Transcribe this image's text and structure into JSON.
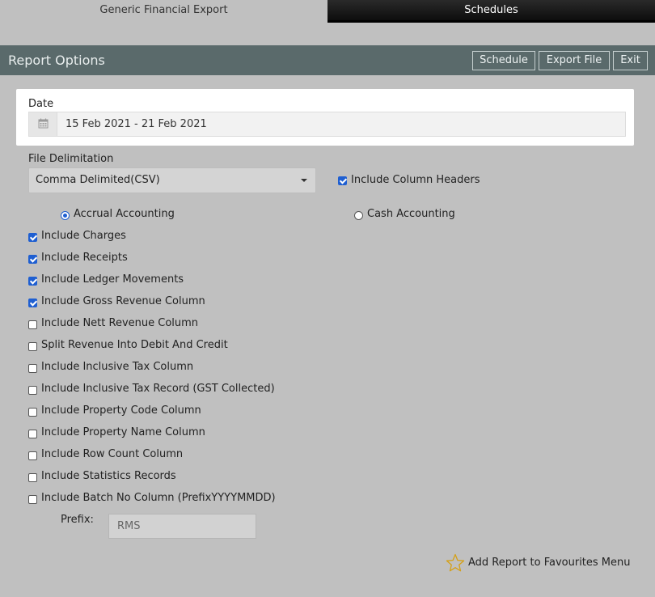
{
  "tabs": [
    {
      "label": "Generic Financial Export"
    },
    {
      "label": "Schedules"
    }
  ],
  "header": {
    "title": "Report Options",
    "buttons": {
      "schedule": "Schedule",
      "export": "Export File",
      "exit": "Exit"
    }
  },
  "date": {
    "label": "Date",
    "value": "15 Feb 2021 - 21 Feb 2021",
    "icon": "calendar-icon"
  },
  "delimitation": {
    "label": "File Delimitation",
    "selected": "Comma Delimited(CSV)"
  },
  "include_column_headers": {
    "label": "Include Column Headers",
    "checked": true
  },
  "accounting": {
    "accrual": {
      "label": "Accrual Accounting",
      "selected": true
    },
    "cash": {
      "label": "Cash Accounting",
      "selected": false
    }
  },
  "options": [
    {
      "label": "Include Charges",
      "checked": true
    },
    {
      "label": "Include Receipts",
      "checked": true
    },
    {
      "label": "Include Ledger Movements",
      "checked": true
    },
    {
      "label": "Include Gross Revenue Column",
      "checked": true
    },
    {
      "label": "Include Nett Revenue Column",
      "checked": false
    },
    {
      "label": "Split Revenue Into Debit And Credit",
      "checked": false
    },
    {
      "label": "Include Inclusive Tax Column",
      "checked": false
    },
    {
      "label": "Include Inclusive Tax Record (GST Collected)",
      "checked": false
    },
    {
      "label": "Include Property Code Column",
      "checked": false
    },
    {
      "label": "Include Property Name Column",
      "checked": false
    },
    {
      "label": "Include Row Count Column",
      "checked": false
    },
    {
      "label": "Include Statistics Records",
      "checked": false
    },
    {
      "label": "Include Batch No Column (PrefixYYYYMMDD)",
      "checked": false
    }
  ],
  "prefix": {
    "label": "Prefix:",
    "value": "RMS"
  },
  "favourites": {
    "label": "Add Report to Favourites Menu",
    "icon": "star-icon"
  },
  "colors": {
    "header_bg": "#5a6a6b",
    "page_bg": "#c0c0c0",
    "check_blue": "#1f5fd1",
    "star": "#d4a017"
  }
}
